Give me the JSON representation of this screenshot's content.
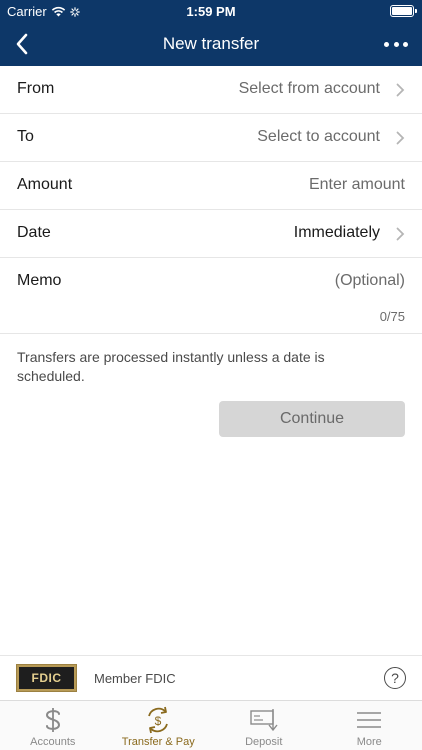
{
  "status_bar": {
    "carrier": "Carrier",
    "time": "1:59 PM"
  },
  "nav": {
    "title": "New transfer",
    "back_icon": "chevron-left-icon",
    "more_icon": "more-dots-icon"
  },
  "form": {
    "from": {
      "label": "From",
      "value": "Select from account"
    },
    "to": {
      "label": "To",
      "value": "Select to account"
    },
    "amount": {
      "label": "Amount",
      "placeholder": "Enter amount"
    },
    "date": {
      "label": "Date",
      "value": "Immediately"
    },
    "memo": {
      "label": "Memo",
      "placeholder": "(Optional)",
      "count": "0/75"
    }
  },
  "info_text": "Transfers are processed instantly unless a date is scheduled.",
  "continue_label": "Continue",
  "footer": {
    "fdic_logo_text": "FDIC",
    "member_text": "Member FDIC",
    "help_symbol": "?"
  },
  "tabs": [
    {
      "label": "Accounts",
      "icon": "dollar-icon",
      "active": false
    },
    {
      "label": "Transfer & Pay",
      "icon": "transfer-pay-icon",
      "active": true
    },
    {
      "label": "Deposit",
      "icon": "deposit-check-icon",
      "active": false
    },
    {
      "label": "More",
      "icon": "menu-lines-icon",
      "active": false
    }
  ],
  "colors": {
    "header_bg": "#0d3768",
    "accent_gold": "#8a6a1e",
    "disabled_button": "#d6d6d6"
  }
}
